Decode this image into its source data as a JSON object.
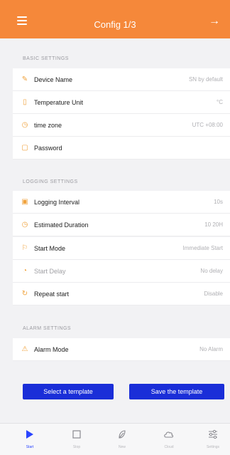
{
  "header": {
    "title": "Config 1/3"
  },
  "sections": {
    "basic": "BASIC SETTINGS",
    "logging": "LOGGING SETTINGS",
    "alarm": "ALARM SETTINGS"
  },
  "basic_rows": [
    {
      "label": "Device Name",
      "value": "SN by default",
      "icon": "device-icon"
    },
    {
      "label": "Temperature Unit",
      "value": "°C",
      "icon": "thermometer-icon"
    },
    {
      "label": "time zone",
      "value": "UTC +08:00",
      "icon": "clock-icon"
    },
    {
      "label": "Password",
      "value": "",
      "icon": "lock-icon"
    }
  ],
  "logging_rows": [
    {
      "label": "Logging Interval",
      "value": "10s",
      "icon": "interval-icon"
    },
    {
      "label": "Estimated Duration",
      "value": "10 20H",
      "icon": "clock-icon"
    },
    {
      "label": "Start Mode",
      "value": "Immediate Start",
      "icon": "start-mode-icon"
    },
    {
      "label": "Start Delay",
      "value": "No delay",
      "icon": "timer-icon"
    },
    {
      "label": "Repeat start",
      "value": "Disable",
      "icon": "repeat-icon"
    }
  ],
  "alarm_rows": [
    {
      "label": "Alarm Mode",
      "value": "No Alarm",
      "icon": "alarm-icon"
    }
  ],
  "buttons": {
    "select_template": "Select a template",
    "save_template": "Save the template"
  },
  "tabs": [
    {
      "label": "Start",
      "icon": "play-icon"
    },
    {
      "label": "Stop",
      "icon": "stop-icon"
    },
    {
      "label": "New",
      "icon": "leaf-icon"
    },
    {
      "label": "Cloud",
      "icon": "cloud-icon"
    },
    {
      "label": "Settings",
      "icon": "sliders-icon"
    }
  ],
  "colors": {
    "header": "#f5883a",
    "button": "#1a2ed8",
    "active_tab": "#2a44ff",
    "icon_accent": "#f0a23c"
  }
}
